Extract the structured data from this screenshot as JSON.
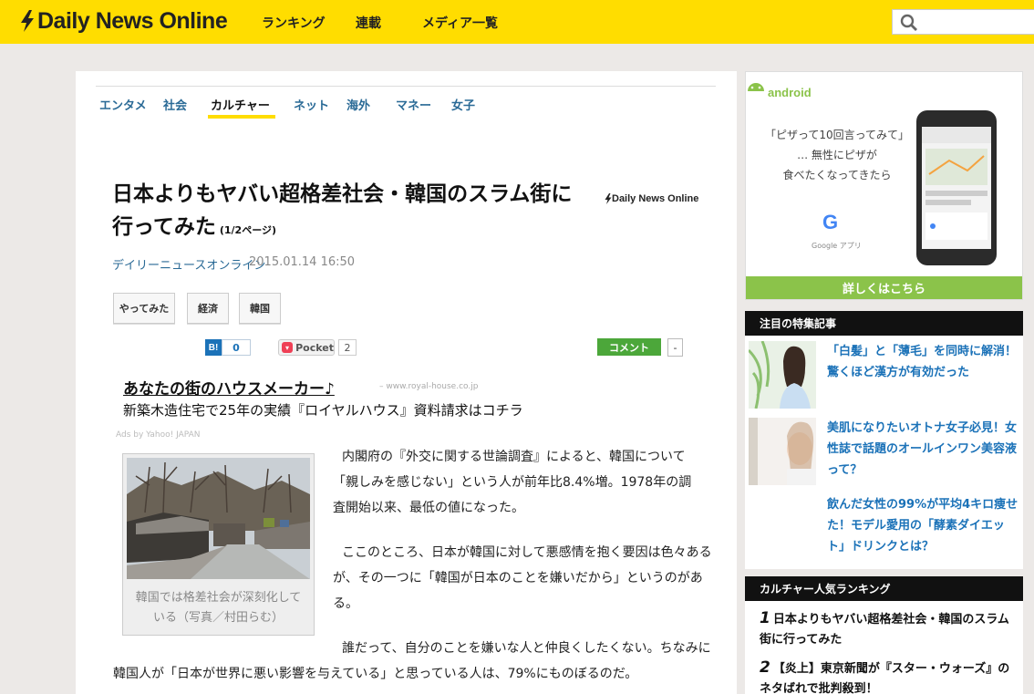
{
  "header": {
    "logo_text": "Daily News Online",
    "nav": [
      "ランキング",
      "連載",
      "メディア一覧"
    ],
    "brand_color": "#ffdd00"
  },
  "categories": {
    "items": [
      "エンタメ",
      "社会",
      "カルチャー",
      "ネット",
      "海外",
      "マネー",
      "女子"
    ],
    "active": "カルチャー"
  },
  "article": {
    "title_line1": "日本よりもヤバい超格差社会・韓国のスラム街に",
    "title_line2": "行ってみた",
    "page_indicator": "(1/2ページ)",
    "inline_logo": "Daily News Online",
    "source": "デイリーニュースオンライン",
    "date": "2015.01.14 16:50",
    "tags": [
      "やってみた",
      "経済",
      "韓国"
    ],
    "social": {
      "hatena_icon": "B!",
      "hatena_count": "0",
      "pocket_label": "Pocket",
      "pocket_count": "2",
      "comment_label": "コメント",
      "comment_count": "-"
    },
    "ad": {
      "title": "あなたの街のハウスメーカー♪",
      "domain": "– www.royal-house.co.jp",
      "desc": "新築木造住宅で25年の実績『ロイヤルハウス』資料請求はコチラ",
      "by": "Ads by Yahoo! JAPAN"
    },
    "photo_caption_line1": "韓国では格差社会が深刻化して",
    "photo_caption_line2": "いる（写真／村田らむ）",
    "para1": [
      "内閣府の『外交に関する世論調査』によると、韓国について",
      "「親しみを感じない」という人が前年比8.4%増。1978年の調",
      "査開始以来、最低の値になった。"
    ],
    "para2": [
      "ここのところ、日本が韓国に対して悪感情を抱く要因は色々ある",
      "が、その一つに「韓国が日本のことを嫌いだから」というのがあ",
      "る。"
    ],
    "para3": [
      "誰だって、自分のことを嫌いな人と仲良くしたくない。ちなみに",
      "韓国人が「日本が世界に悪い影響を与えている」と思っている人は、79%にものぼるのだ。"
    ]
  },
  "side_ad": {
    "brand": "android",
    "copy_line1": "「ピザって10回言ってみて」",
    "copy_line2": "… 無性にピザが",
    "copy_line3": "食べたくなってきたら",
    "g_letter": "G",
    "app_label": "Google アプリ",
    "more": "詳しくはこちら"
  },
  "featured": {
    "heading": "注目の特集記事",
    "items": [
      "「白髪」と「薄毛」を同時に解消！驚くほど漢方が有効だった",
      "美肌になりたいオトナ女子必見！女性誌で話題のオールインワン美容液って？",
      "飲んだ女性の99%が平均4キロ痩せた！モデル愛用の「酵素ダイエット」ドリンクとは？"
    ]
  },
  "ranking": {
    "heading": "カルチャー人気ランキング",
    "items": [
      {
        "no": "1",
        "text": "日本よりもヤバい超格差社会・韓国のスラム街に行ってみた"
      },
      {
        "no": "2",
        "text": "【炎上】東京新聞が『スター・ウォーズ』のネタばれで批判殺到！"
      }
    ]
  }
}
